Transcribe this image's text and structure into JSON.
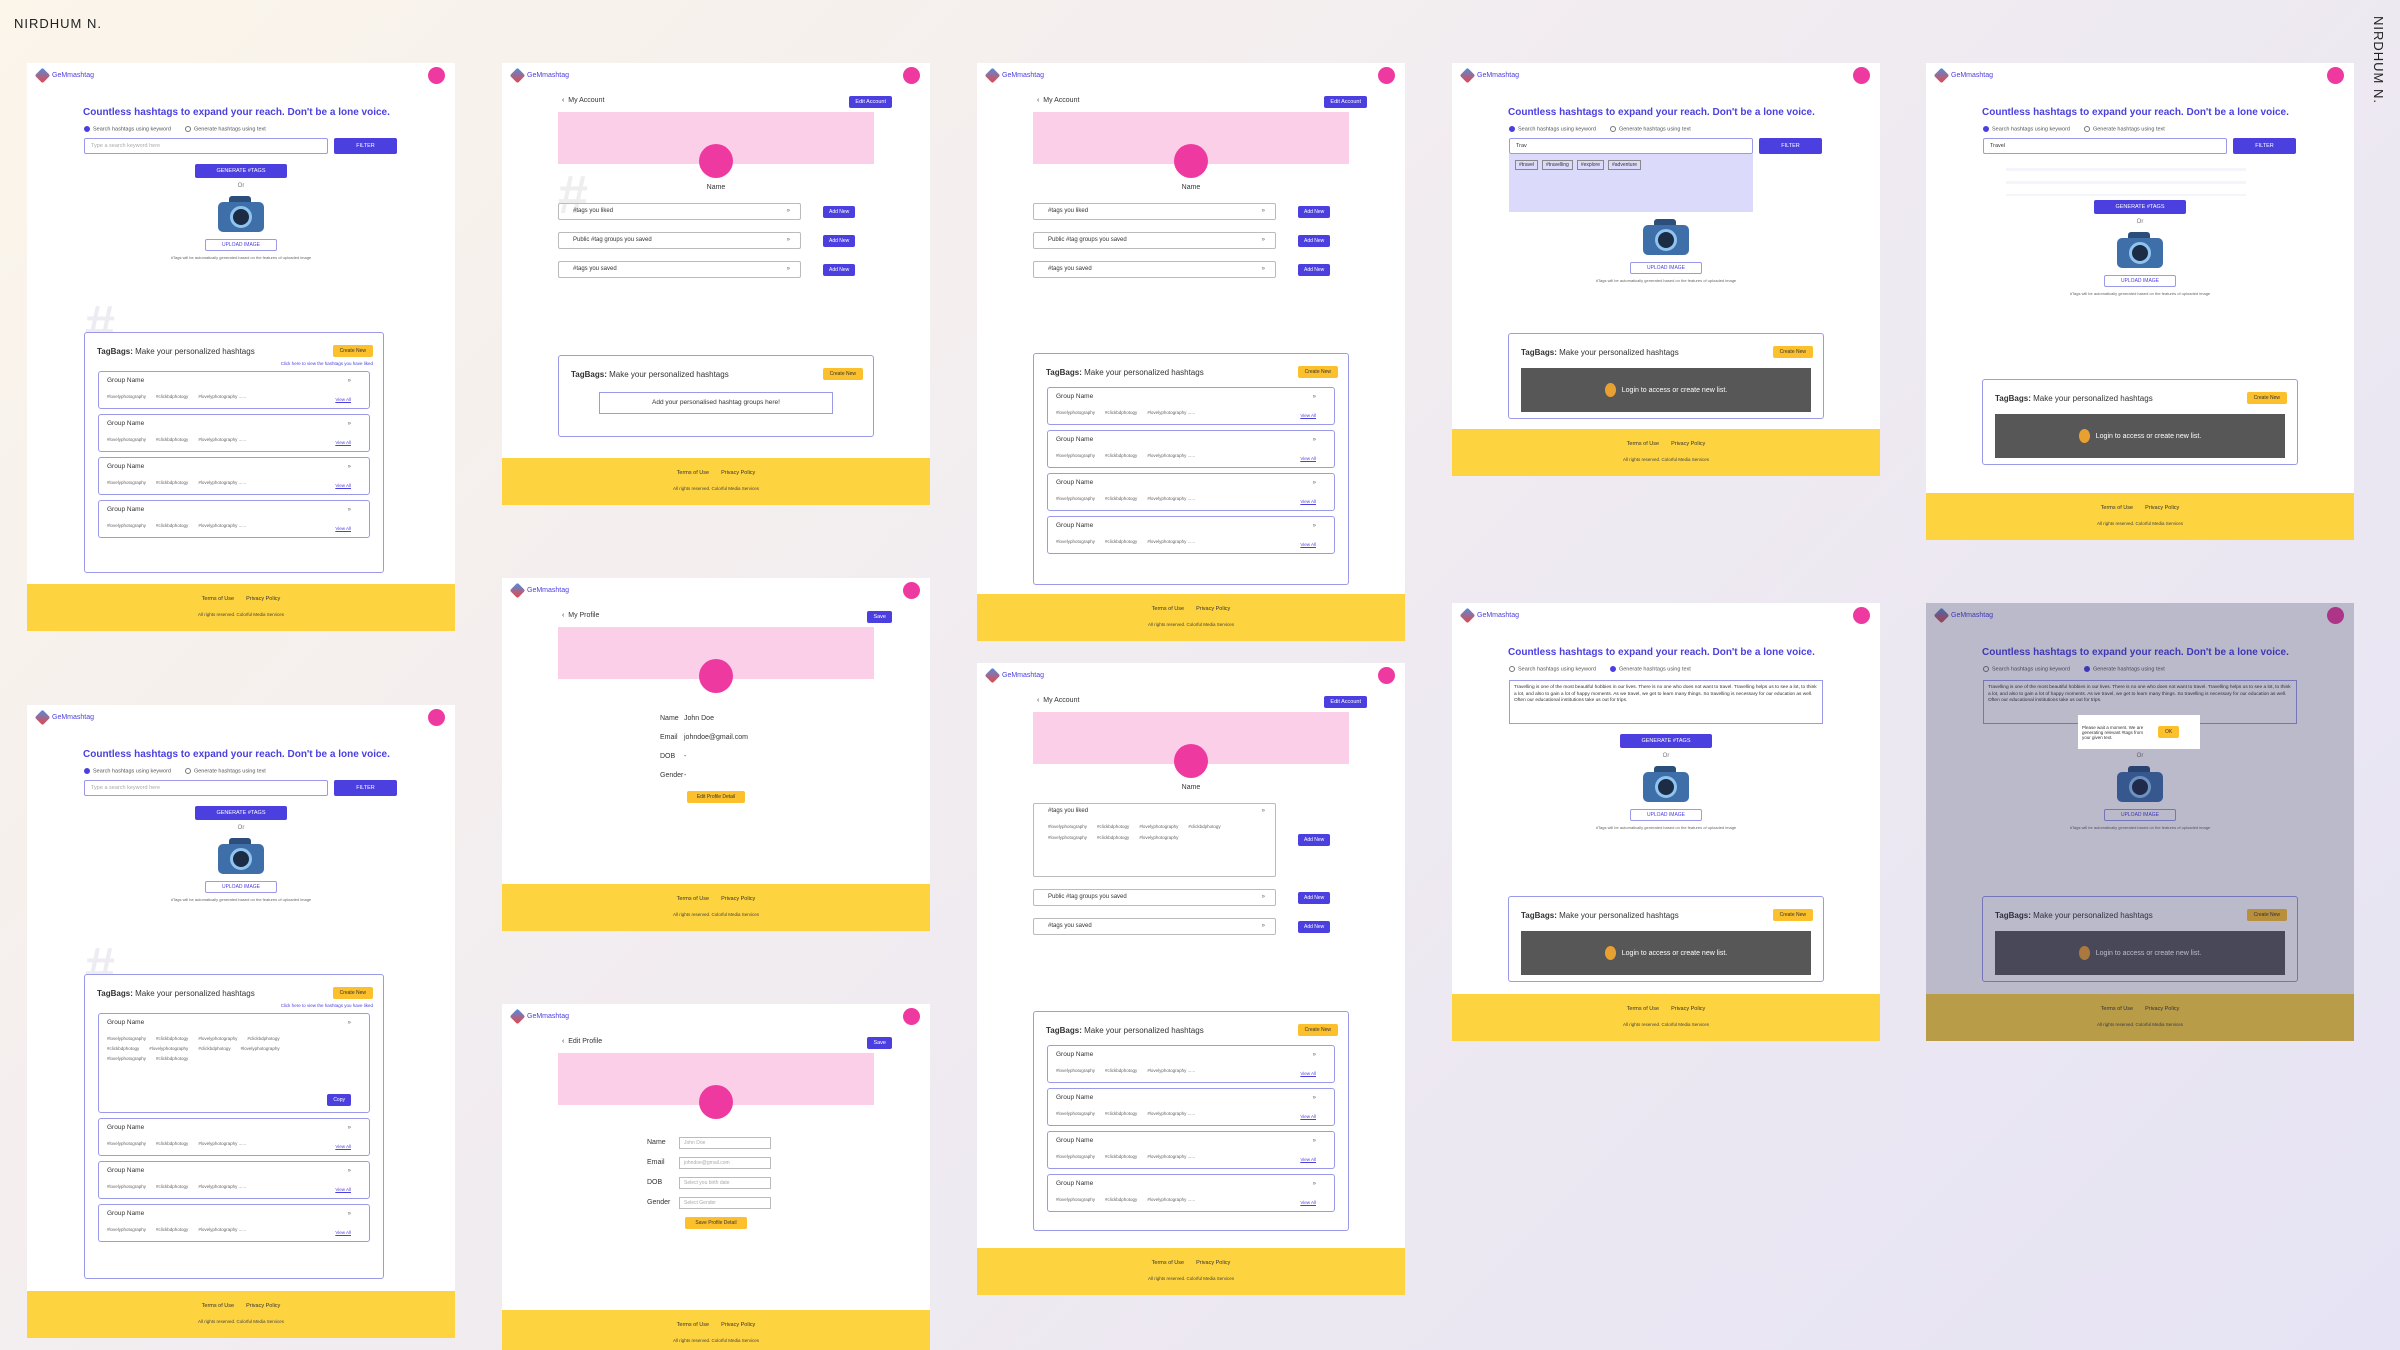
{
  "author": "NIRDHUM N.",
  "app": {
    "name": "GeMmashtag"
  },
  "home": {
    "title": "Countless hashtags to expand your reach. Don't be a lone voice.",
    "radio_keyword": "Search hashtags using keyword",
    "radio_text": "Generate hashtags using text",
    "search_placeholder": "Type a search keyword here",
    "filter": "FILTER",
    "generate": "GENERATE #TAGS",
    "or": "Or",
    "upload": "UPLOAD IMAGE",
    "note": "#Tags will be automatically generated based on the features of uploaded image"
  },
  "tagbags": {
    "title_bold": "TagBags:",
    "title_rest": " Make your personalized hashtags",
    "create": "Create New",
    "link": "Click here to view the hashtags you have liked",
    "group": "Group Name",
    "tags": [
      "#lovelyphotography",
      "#clickbdphotogy",
      "#lovelyphotography ......"
    ],
    "view": "View All",
    "add_prompt": "Add your personalised hashtag groups here!",
    "login": "Login to access or create new list."
  },
  "account": {
    "back": "My Account",
    "edit": "Edit Account",
    "name": "Name",
    "liked": "#tags you liked",
    "public": "Public #tag groups you saved",
    "saved": "#tags you saved",
    "add": "Add New"
  },
  "profile": {
    "back": "My Profile",
    "save": "Save",
    "name_l": "Name",
    "email_l": "Email",
    "dob_l": "DOB",
    "gender_l": "Gender",
    "name": "John Doe",
    "email": "johndoe@gmail.com",
    "dob": "-",
    "gender": "-",
    "edit_btn": "Edit Profile Detail"
  },
  "edit": {
    "back": "Edit Profile",
    "save": "Save",
    "name_ph": "John Doe",
    "email_ph": "johndoe@gmail.com",
    "dob_ph": "Select you birth date",
    "gender_ph": "Select Gender",
    "save_btn": "Save Profile Detail"
  },
  "footer": {
    "terms": "Terms of Use",
    "privacy": "Privacy Policy",
    "copy": "All rights reserved. Colorful Media Services"
  },
  "search": {
    "keyword": "Trav",
    "chips": [
      "#travel",
      "#travelling",
      "#explore",
      "#adventure"
    ],
    "keyword2": "Travel",
    "text": "Travelling is one of the most beautiful hobbies in our lives. There is no one who does not want to travel. Travelling helps us to see a lot, to think a lot, and also to gain a lot of happy moments. As we travel, we get to learn many things. So travelling is necessary for our education as well. Often our educational institutions take us out for trips.",
    "popup": "Please wait a moment. We are generating relevant #tags from your given text.",
    "ok": "OK"
  }
}
